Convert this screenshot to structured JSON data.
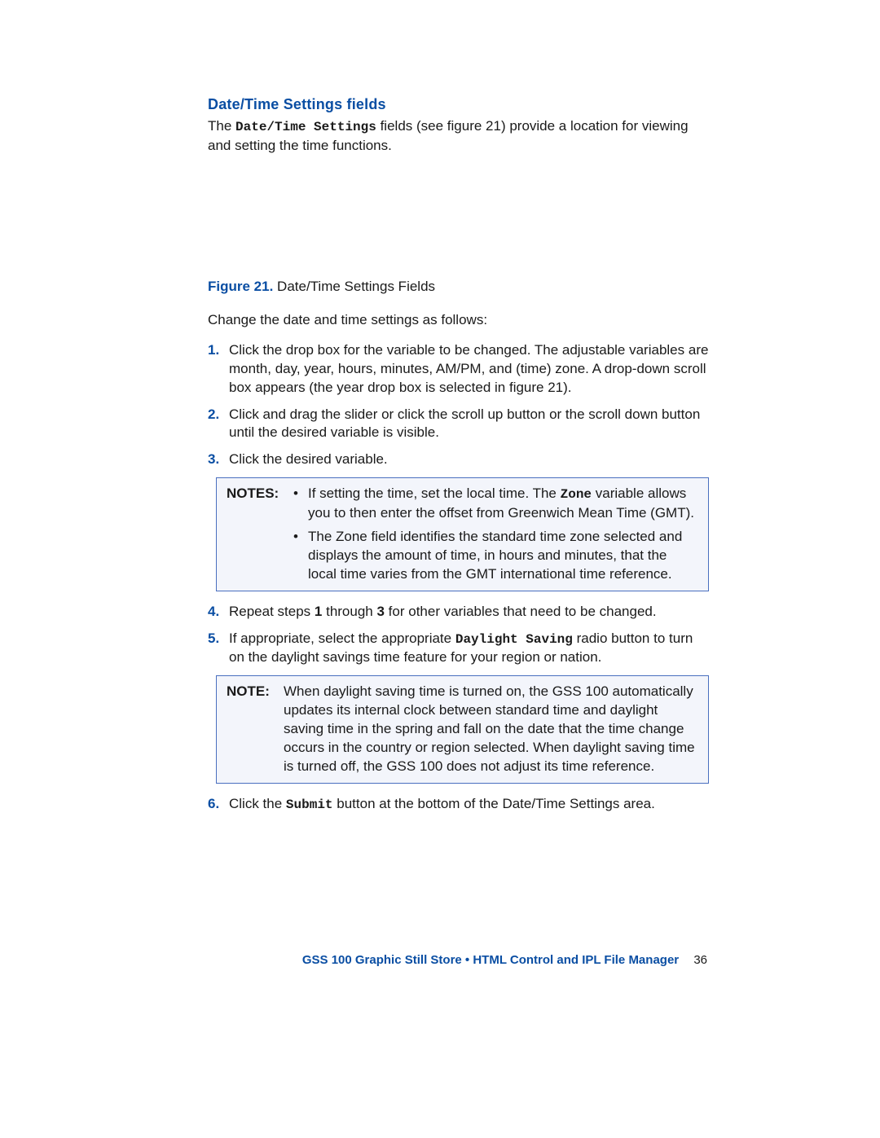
{
  "heading": "Date/Time Settings fields",
  "intro": {
    "pre": "The ",
    "mono": "Date/Time Settings",
    "post": " fields (see figure 21) provide a location for viewing and setting the time functions."
  },
  "figure": {
    "label": "Figure 21.",
    "caption": " Date/Time Settings Fields"
  },
  "lead": "Change the date and time settings as follows:",
  "steps": {
    "s1": {
      "num": "1.",
      "text": "Click the drop box for the variable to be changed. The adjustable variables are month, day, year, hours, minutes, AM/PM, and (time) zone. A drop-down scroll box appears (the year drop box is selected in figure 21)."
    },
    "s2": {
      "num": "2.",
      "text": "Click and drag the slider or click the scroll up      button or the scroll down      button until the desired variable is visible."
    },
    "s3": {
      "num": "3.",
      "text": "Click the desired variable."
    },
    "s4": {
      "num": "4.",
      "text_pre": "Repeat steps ",
      "b1": "1",
      "mid": " through ",
      "b2": "3",
      "text_post": " for other variables that need to be changed."
    },
    "s5": {
      "num": "5.",
      "pre": "If appropriate, select the appropriate ",
      "mono": "Daylight Saving",
      "post": " radio button to turn on the daylight savings time feature for your region or nation."
    },
    "s6": {
      "num": "6.",
      "pre": "Click the ",
      "mono": "Submit",
      "post": " button at the bottom of the Date/Time Settings area."
    }
  },
  "notes1": {
    "label": "NOTES:",
    "bullets": {
      "b1": {
        "pre": "If setting the time, set the local time. The ",
        "mono": "Zone",
        "post": " variable allows you to then enter the offset from Greenwich Mean Time (GMT)."
      },
      "b2": "The Zone field identifies the standard time zone selected and displays the amount of time, in hours and minutes, that the local time varies from the GMT international time reference."
    }
  },
  "note2": {
    "label": "NOTE:",
    "text": "When daylight saving time is turned on, the GSS 100 automatically updates its internal clock between standard time and daylight saving time in the spring and fall on the date that the time change occurs in the country or region selected. When daylight saving time is turned off, the GSS 100 does not adjust its time reference."
  },
  "footer": {
    "title": "GSS 100 Graphic Still Store • HTML Control and IPL File Manager",
    "page": "36"
  }
}
